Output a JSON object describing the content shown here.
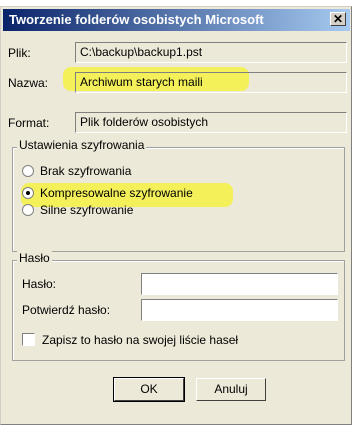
{
  "dialog": {
    "title": "Tworzenie folderów osobistych Microsoft",
    "close_glyph": "✕"
  },
  "file": {
    "label": "Plik:",
    "value": "C:\\backup\\backup1.pst"
  },
  "name": {
    "label": "Nazwa:",
    "value": "Archiwum starych maili"
  },
  "format": {
    "label": "Format:",
    "value": "Plik folderów osobistych"
  },
  "encryption": {
    "legend": "Ustawienia szyfrowania",
    "options": [
      {
        "label": "Brak szyfrowania",
        "selected": false
      },
      {
        "label": "Kompresowalne szyfrowanie",
        "selected": true
      },
      {
        "label": "Silne szyfrowanie",
        "selected": false
      }
    ]
  },
  "password": {
    "legend": "Hasło",
    "password_label": "Hasło:",
    "confirm_label": "Potwierdź hasło:",
    "save_checkbox_label": "Zapisz to hasło na swojej liście haseł",
    "save_checked": false
  },
  "buttons": {
    "ok": "OK",
    "cancel": "Anuluj"
  },
  "colors": {
    "title_gradient_start": "#0a246a",
    "title_gradient_end": "#a6caf0",
    "dialog_bg": "#ece9d8",
    "highlight": "#f5f230"
  }
}
